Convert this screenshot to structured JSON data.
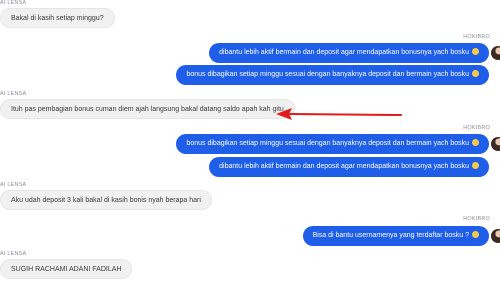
{
  "colors": {
    "agent_bubble": "#f1f1f1",
    "user_bubble": "#1f5ee8",
    "arrow": "#e11a1a"
  },
  "messages": [
    {
      "sender": "AI LENSA",
      "text": "Bakal di kasih setiap minggu?",
      "side": "left"
    },
    {
      "sender": "HOKIBRO",
      "text": "dibantu lebih aktif bermain dan deposit agar mendapatkan bonusnya yach bosku",
      "side": "right",
      "emoji": "smile-emoji"
    },
    {
      "sender": "",
      "text": "bonus dibagikan setiap minggu sesuai dengan banyaknya deposit dan bermain yach bosku",
      "side": "right",
      "emoji": "smile-emoji"
    },
    {
      "sender": "AI LENSA",
      "text": "Ituh pas pembagian bonus cuman diem ajah langsung bakal datang saldo apah kah gitu",
      "side": "left"
    },
    {
      "sender": "HOKIBRO",
      "text": "bonus dibagikan setiap minggu sesuai dengan banyaknya deposit dan bermain yach bosku",
      "side": "right",
      "emoji": "smile-emoji"
    },
    {
      "sender": "",
      "text": "dibantu lebih aktif bermain dan deposit agar mendapatkan bonusnya yach bosku",
      "side": "right",
      "emoji": "smile-emoji"
    },
    {
      "sender": "AI LENSA",
      "text": "Aku udah deposit 3 kali bakal di kasih bonis nyah berapa hari",
      "side": "left"
    },
    {
      "sender": "HOKIBRO",
      "text": "Bisa di bantu usernamenya yang terdaftar bosku ?",
      "side": "right",
      "emoji": "smile-emoji"
    },
    {
      "sender": "AI LENSA",
      "text": "SUGIH RACHAMI ADANI FADILAH",
      "side": "left"
    }
  ]
}
